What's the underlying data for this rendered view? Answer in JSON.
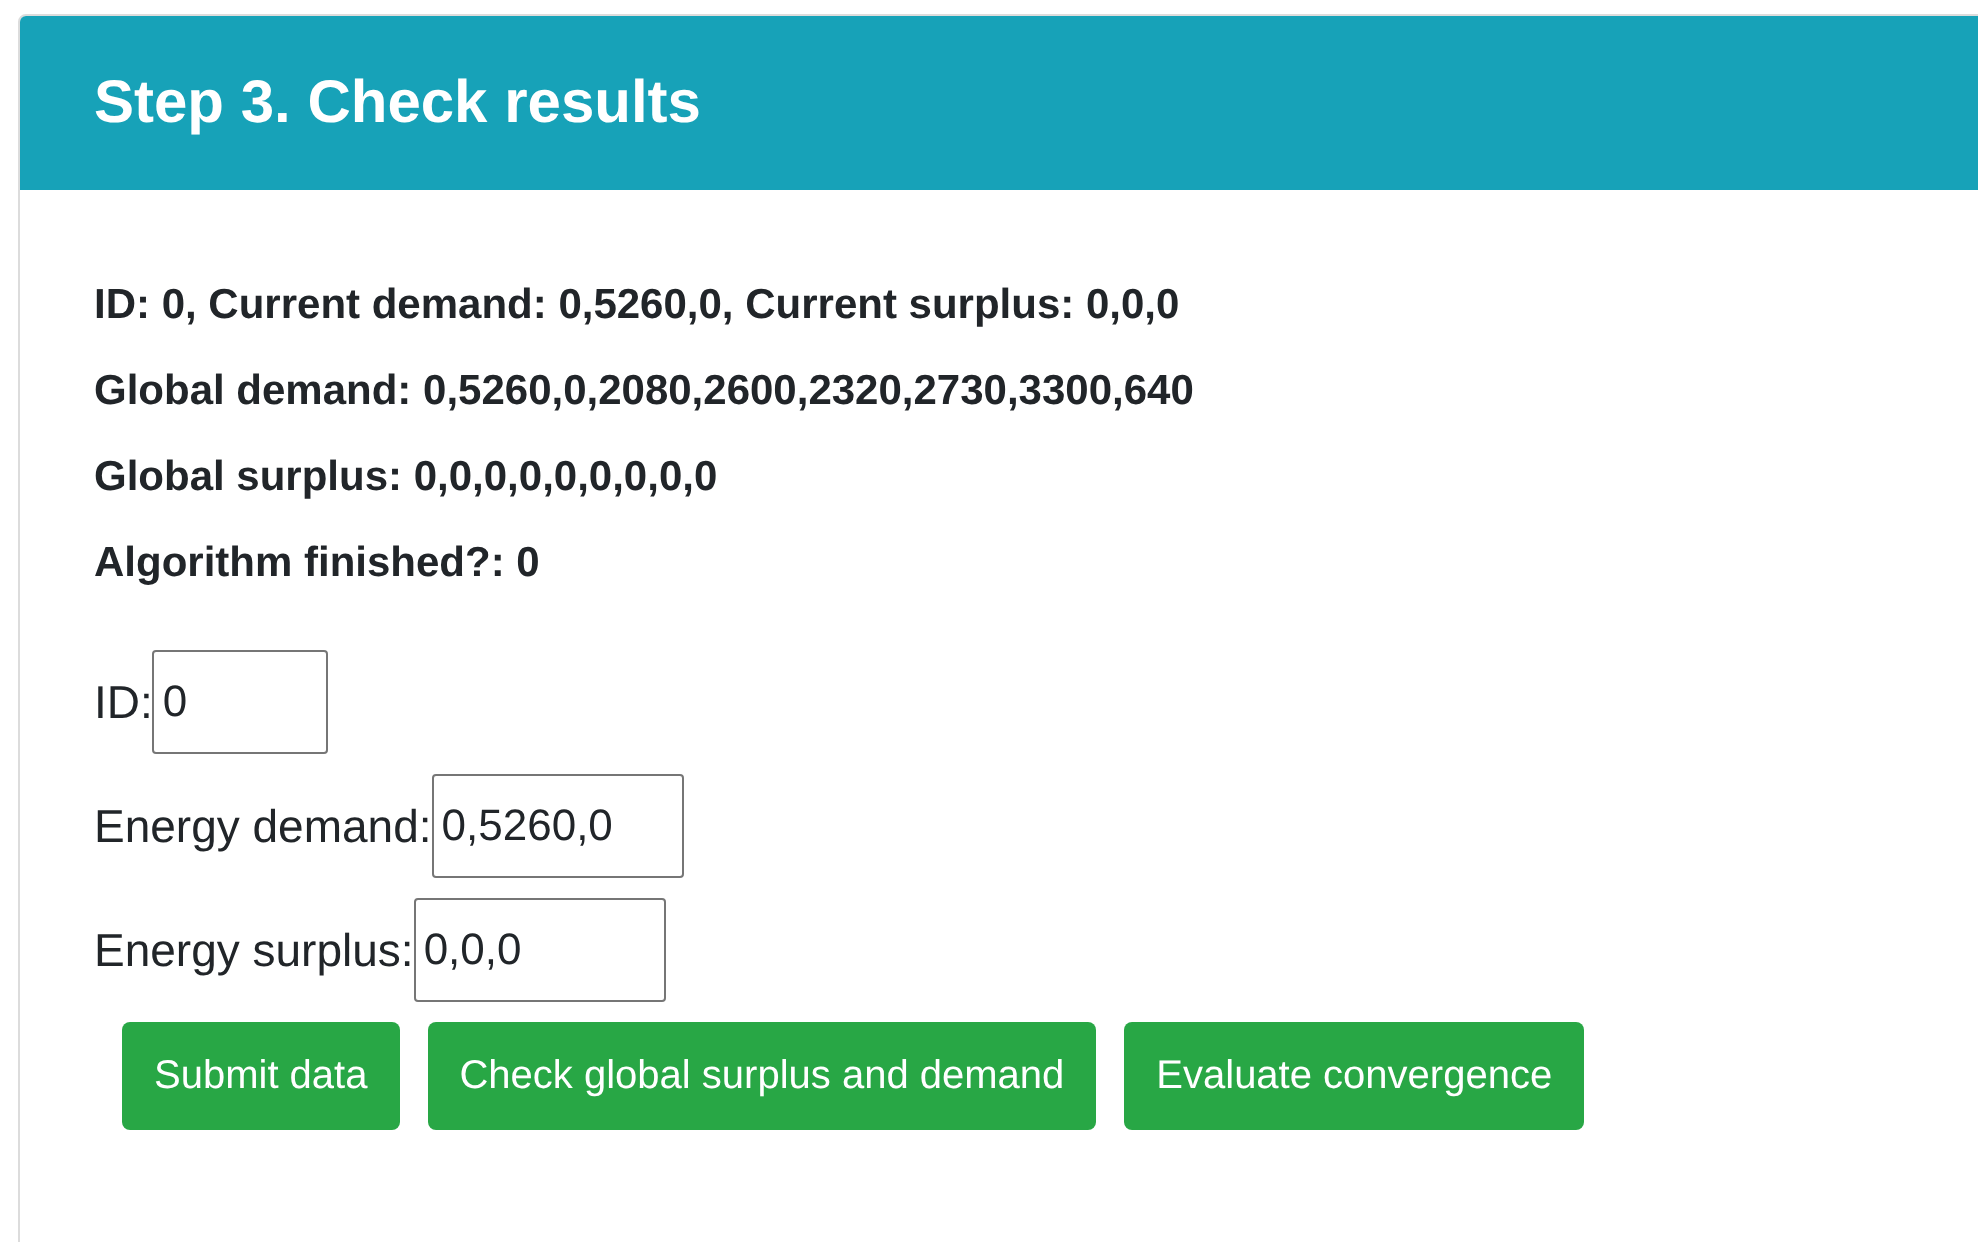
{
  "card": {
    "title": "Step 3. Check results"
  },
  "status_lines": [
    "ID: 0, Current demand: 0,5260,0, Current surplus: 0,0,0",
    "Global demand: 0,5260,0,2080,2600,2320,2730,3300,640",
    "Global surplus: 0,0,0,0,0,0,0,0,0",
    "Algorithm finished?: 0"
  ],
  "fields": [
    {
      "label": "ID:",
      "value": "0"
    },
    {
      "label": "Energy demand:",
      "value": "0,5260,0"
    },
    {
      "label": "Energy surplus:",
      "value": "0,0,0"
    }
  ],
  "buttons": [
    "Submit data",
    "Check global surplus and demand",
    "Evaluate convergence"
  ]
}
